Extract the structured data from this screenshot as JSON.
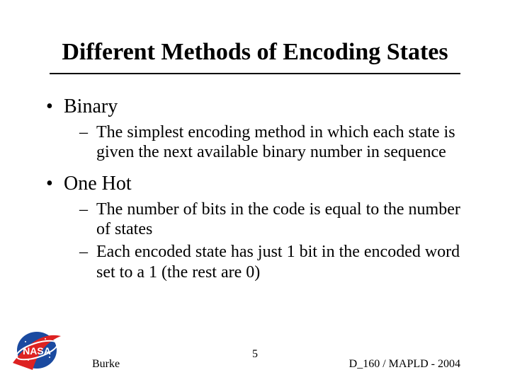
{
  "title": "Different Methods of Encoding States",
  "bullets": [
    {
      "label": "Binary",
      "sub": [
        "The simplest encoding method in which each state is given the next available binary number in sequence"
      ]
    },
    {
      "label": "One Hot",
      "sub": [
        "The number of bits in the code is equal to the number of states",
        "Each encoded state has just 1 bit in the encoded word set to a 1 (the rest are 0)"
      ]
    }
  ],
  "footer": {
    "author": "Burke",
    "page": "5",
    "conference": "D_160 / MAPLD - 2004"
  }
}
